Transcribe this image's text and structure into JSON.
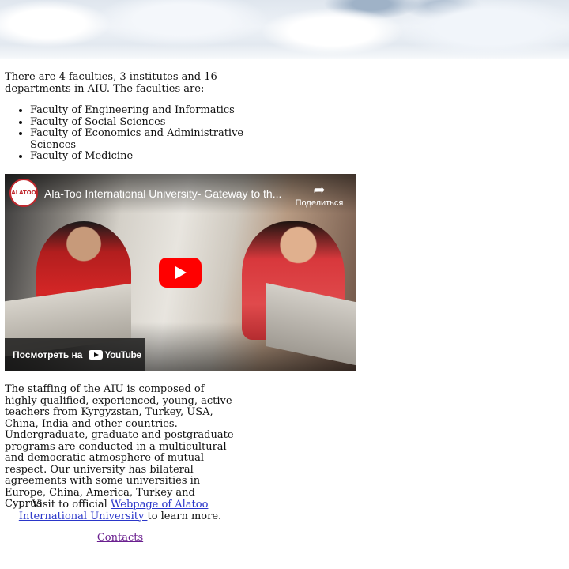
{
  "intro": "There are 4 faculties, 3 institutes and 16 departments in AIU. The faculties are:",
  "faculties": [
    "Faculty of Engineering and Informatics",
    "Faculty of Social Sciences",
    "Faculty of Economics and Administrative Sciences",
    "Faculty of Medicine"
  ],
  "video": {
    "channel_logo": "ALATOO",
    "title": "Ala-Too International University- Gateway to th...",
    "share_icon": "share-arrow-icon",
    "share_label": "Поделиться",
    "play_icon": "play-icon",
    "watch_on_label": "Посмотреть на",
    "youtube_label": "YouTube"
  },
  "staffing": "The staffing of the AIU is composed of highly qualified, experienced, young, active teachers from Kyrgyzstan, Turkey, USA, China, India and other countries. Undergraduate, graduate and postgraduate programs are conducted in a multicultural and democratic atmosphere of mutual respect. Our university has bilateral agreements with some universities in Europe, China, America, Turkey and Cyprus.",
  "visit": {
    "prefix": "Visit to official ",
    "link_text": "Webpage of Alatoo International University ",
    "suffix": "to learn more."
  },
  "contacts_link": "Contacts",
  "colors": {
    "link": "#2a36c9",
    "visited_link": "#6a1f8f",
    "play_button": "#ff0000"
  }
}
